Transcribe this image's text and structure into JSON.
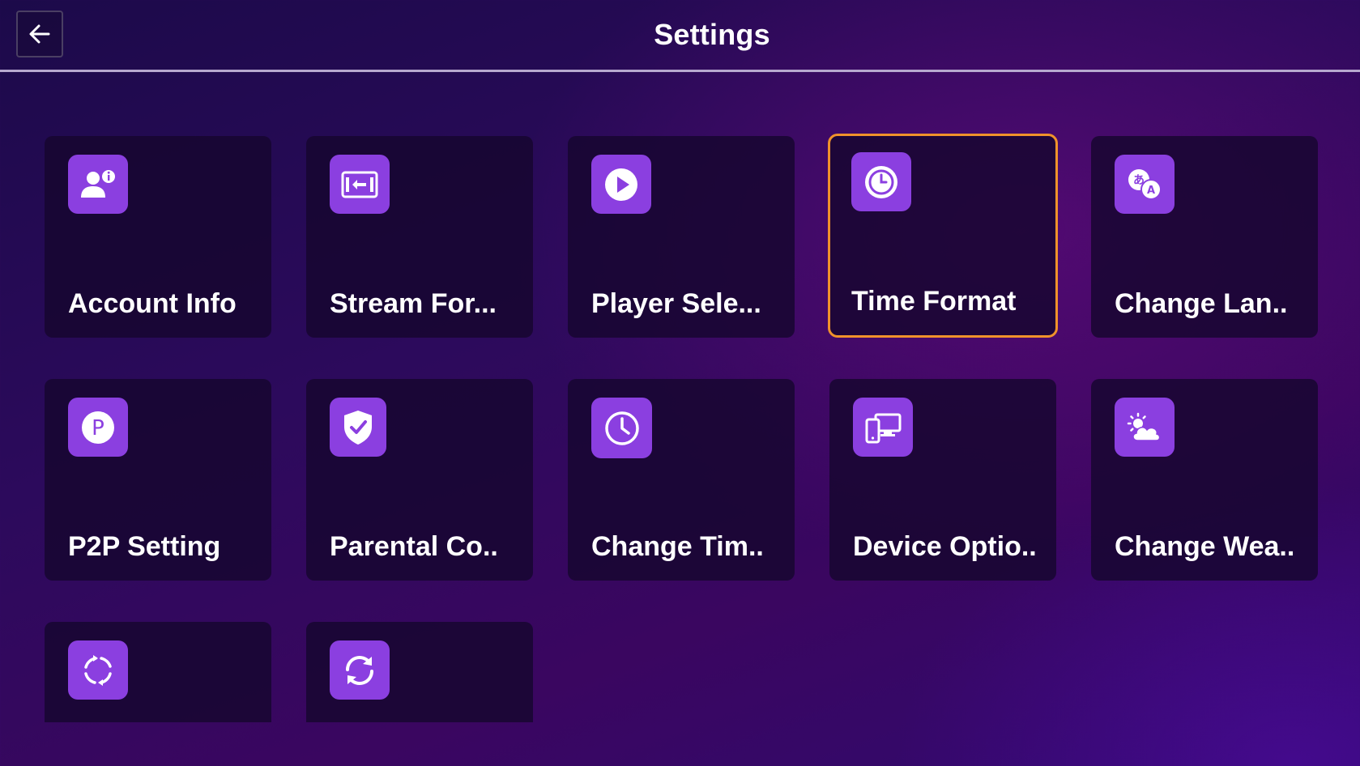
{
  "header": {
    "title": "Settings",
    "back_icon": "arrow-left-icon"
  },
  "colors": {
    "tile_icon_bg": "#8b3fe0",
    "focus_border": "#f0922b",
    "tile_bg": "#16062e",
    "divider": "#b7a9cf"
  },
  "tiles": [
    {
      "label": "Account Info",
      "icon": "account-info-icon"
    },
    {
      "label": "Stream For...",
      "icon": "stream-format-icon"
    },
    {
      "label": "Player Sele...",
      "icon": "play-icon"
    },
    {
      "label": "Time Format",
      "icon": "clock-icon",
      "focused": true
    },
    {
      "label": "Change Lan..",
      "icon": "translate-icon"
    },
    {
      "label": "P2P Setting",
      "icon": "p2p-icon"
    },
    {
      "label": "Parental Co..",
      "icon": "shield-check-icon"
    },
    {
      "label": "Change Tim..",
      "icon": "clock-outline-icon"
    },
    {
      "label": "Device Optio..",
      "icon": "devices-icon"
    },
    {
      "label": "Change Wea..",
      "icon": "weather-icon"
    },
    {
      "label": "",
      "icon": "refresh-dashed-icon"
    },
    {
      "label": "",
      "icon": "sync-icon"
    }
  ]
}
